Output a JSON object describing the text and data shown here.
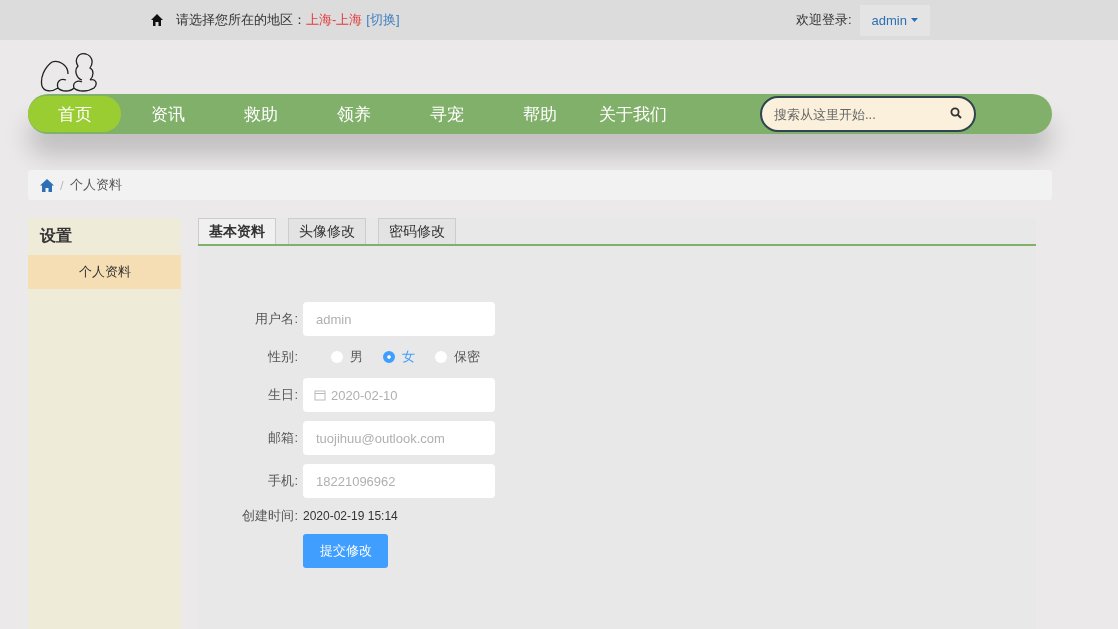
{
  "top_bar": {
    "region_prompt": "请选择您所在的地区：",
    "region": "上海-上海",
    "switch_link": "[切换]",
    "welcome": "欢迎登录:",
    "user": "admin"
  },
  "nav": {
    "items": [
      {
        "label": "首页",
        "selected": true
      },
      {
        "label": "资讯",
        "selected": false
      },
      {
        "label": "救助",
        "selected": false
      },
      {
        "label": "领养",
        "selected": false
      },
      {
        "label": "寻宠",
        "selected": false
      },
      {
        "label": "帮助",
        "selected": false
      },
      {
        "label": "关于我们",
        "selected": false
      }
    ],
    "search": {
      "placeholder": "搜索从这里开始..."
    }
  },
  "breadcrumb": {
    "separator": "/",
    "current": "个人资料"
  },
  "sidebar": {
    "title": "设置",
    "items": [
      {
        "label": "个人资料",
        "selected": true
      }
    ]
  },
  "tabs": [
    {
      "label": "基本资料",
      "selected": true
    },
    {
      "label": "头像修改",
      "selected": false
    },
    {
      "label": "密码修改",
      "selected": false
    }
  ],
  "form": {
    "fields": [
      {
        "kind": "text",
        "label": "用户名:",
        "placeholder": "admin"
      },
      {
        "kind": "radio",
        "label": "性别:",
        "options": [
          {
            "label": "男",
            "selected": false
          },
          {
            "label": "女",
            "selected": true
          },
          {
            "label": "保密",
            "selected": false
          }
        ]
      },
      {
        "kind": "date",
        "label": "生日:",
        "placeholder": "2020-02-10"
      },
      {
        "kind": "text",
        "label": "邮箱:",
        "placeholder": "tuojihuu@outlook.com"
      },
      {
        "kind": "text",
        "label": "手机:",
        "placeholder": "18221096962"
      },
      {
        "kind": "info",
        "label": "创建时间:",
        "value": "2020-02-19 15:14"
      }
    ],
    "submit": "提交修改"
  }
}
